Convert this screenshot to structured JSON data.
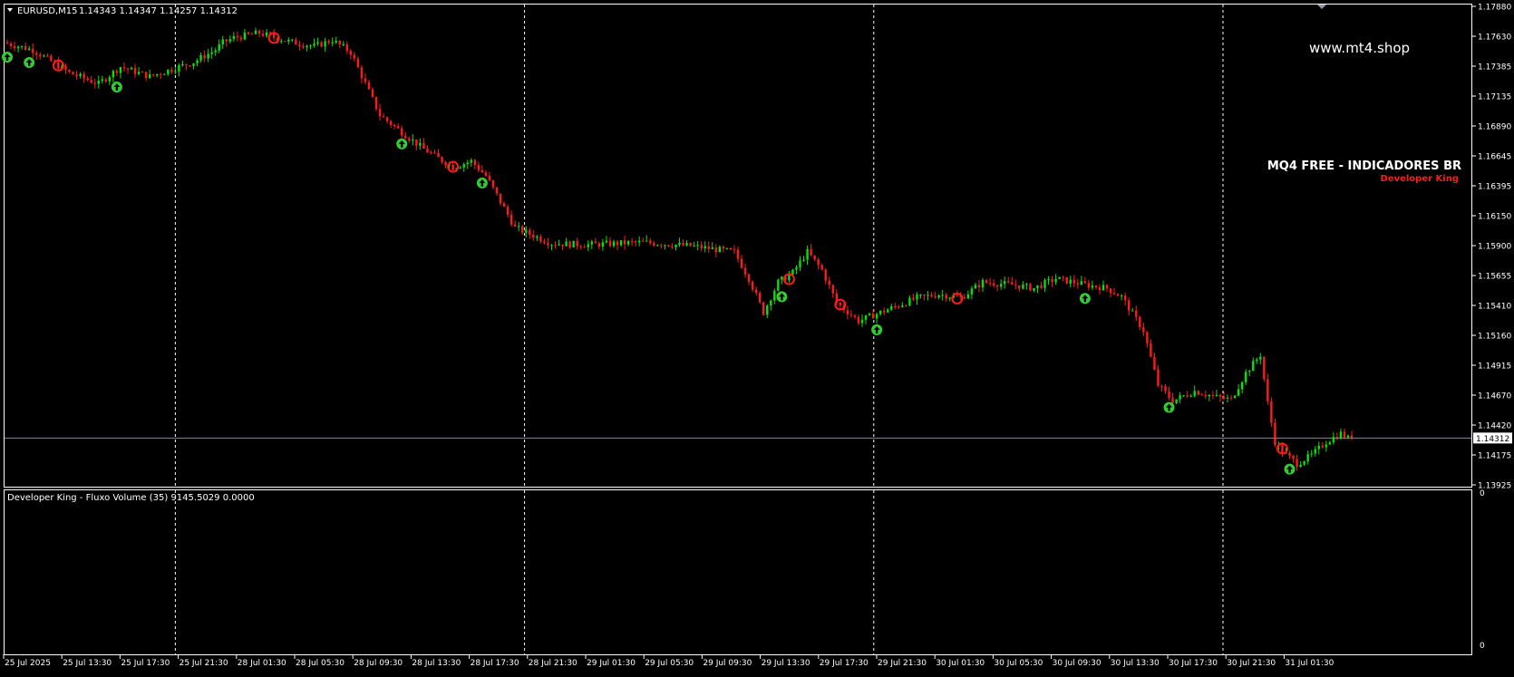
{
  "main_header": {
    "symbol": "EURUSD,M15",
    "ohlc": "1.14343 1.14347 1.14257 1.14312"
  },
  "watermark": "www.mt4.shop",
  "brand": {
    "title": "MQ4 FREE - INDICADORES BR",
    "subtitle": "Developer King"
  },
  "indicator_header": "Developer King - Fluxo Volume  (35) 9145.5029 0.0000",
  "colors": {
    "background": "#000000",
    "frame": "#ffffff",
    "bull": "#00e600",
    "bear": "#ff1a1a",
    "buy_arrow": "#33cc33",
    "sell_circle": "#ff1a1a",
    "price_line": "#7f8a9c",
    "brand_title": "#ffffff",
    "brand_sub": "#ff1a1a"
  },
  "chart_data": {
    "type": "candlestick",
    "price_axis_labels": [
      "1.17880",
      "1.17630",
      "1.17385",
      "1.17135",
      "1.16890",
      "1.16645",
      "1.16395",
      "1.16150",
      "1.15900",
      "1.15655",
      "1.15410",
      "1.15160",
      "1.14915",
      "1.14670",
      "1.14420",
      "1.14175",
      "1.13925"
    ],
    "ylim": [
      1.13925,
      1.1788
    ],
    "current_price": "1.14312",
    "current_price_value": 1.14312,
    "time_axis_labels": [
      "25 Jul 2025",
      "25 Jul 13:30",
      "25 Jul 17:30",
      "25 Jul 21:30",
      "28 Jul 01:30",
      "28 Jul 05:30",
      "28 Jul 09:30",
      "28 Jul 13:30",
      "28 Jul 17:30",
      "28 Jul 21:30",
      "29 Jul 01:30",
      "29 Jul 05:30",
      "29 Jul 09:30",
      "29 Jul 13:30",
      "29 Jul 17:30",
      "29 Jul 21:30",
      "30 Jul 01:30",
      "30 Jul 05:30",
      "30 Jul 09:30",
      "30 Jul 13:30",
      "30 Jul 17:30",
      "30 Jul 21:30",
      "31 Jul 01:30"
    ],
    "day_separators_after_label": [
      "25 Jul 17:30",
      "28 Jul 17:30",
      "29 Jul 17:30",
      "30 Jul 17:30"
    ],
    "candle_count": 360,
    "price_path": [
      [
        0,
        1.1758
      ],
      [
        8,
        1.1752
      ],
      [
        18,
        1.1733
      ],
      [
        26,
        1.1724
      ],
      [
        32,
        1.1738
      ],
      [
        40,
        1.173
      ],
      [
        52,
        1.1742
      ],
      [
        58,
        1.1752
      ],
      [
        60,
        1.1758
      ],
      [
        63,
        1.1762
      ],
      [
        70,
        1.1766
      ],
      [
        78,
        1.1759
      ],
      [
        85,
        1.1755
      ],
      [
        90,
        1.176
      ],
      [
        95,
        1.175
      ],
      [
        103,
        1.1698
      ],
      [
        115,
        1.167
      ],
      [
        123,
        1.1655
      ],
      [
        128,
        1.166
      ],
      [
        132,
        1.1648
      ],
      [
        140,
        1.1605
      ],
      [
        150,
        1.1592
      ],
      [
        160,
        1.1591
      ],
      [
        175,
        1.1593
      ],
      [
        188,
        1.159
      ],
      [
        200,
        1.1585
      ],
      [
        204,
        1.1563
      ],
      [
        208,
        1.1535
      ],
      [
        212,
        1.156
      ],
      [
        216,
        1.1568
      ],
      [
        220,
        1.1585
      ],
      [
        224,
        1.157
      ],
      [
        228,
        1.1543
      ],
      [
        234,
        1.1528
      ],
      [
        240,
        1.1535
      ],
      [
        250,
        1.1547
      ],
      [
        256,
        1.155
      ],
      [
        262,
        1.1547
      ],
      [
        268,
        1.156
      ],
      [
        276,
        1.1558
      ],
      [
        282,
        1.1555
      ],
      [
        288,
        1.1563
      ],
      [
        296,
        1.1558
      ],
      [
        302,
        1.1555
      ],
      [
        306,
        1.1548
      ],
      [
        312,
        1.152
      ],
      [
        316,
        1.1475
      ],
      [
        320,
        1.1462
      ],
      [
        326,
        1.147
      ],
      [
        332,
        1.1465
      ],
      [
        336,
        1.1463
      ],
      [
        340,
        1.1485
      ],
      [
        344,
        1.15
      ],
      [
        346,
        1.146
      ],
      [
        348,
        1.1428
      ],
      [
        350,
        1.142
      ],
      [
        354,
        1.141
      ],
      [
        358,
        1.1417
      ],
      [
        362,
        1.1428
      ],
      [
        366,
        1.1435
      ],
      [
        368,
        1.1431
      ]
    ],
    "buy_arrows_at_candle": [
      0,
      30,
      108,
      130,
      212,
      238,
      295,
      351,
      318,
      6
    ],
    "sell_circles_at_candle": [
      14,
      73,
      122,
      214,
      228,
      260,
      349
    ],
    "indicator": {
      "name": "Developer King - Fluxo Volume",
      "period": 35,
      "value_1": 9145.5029,
      "value_2": 0.0,
      "axis_labels": [
        "0",
        "0"
      ]
    }
  }
}
